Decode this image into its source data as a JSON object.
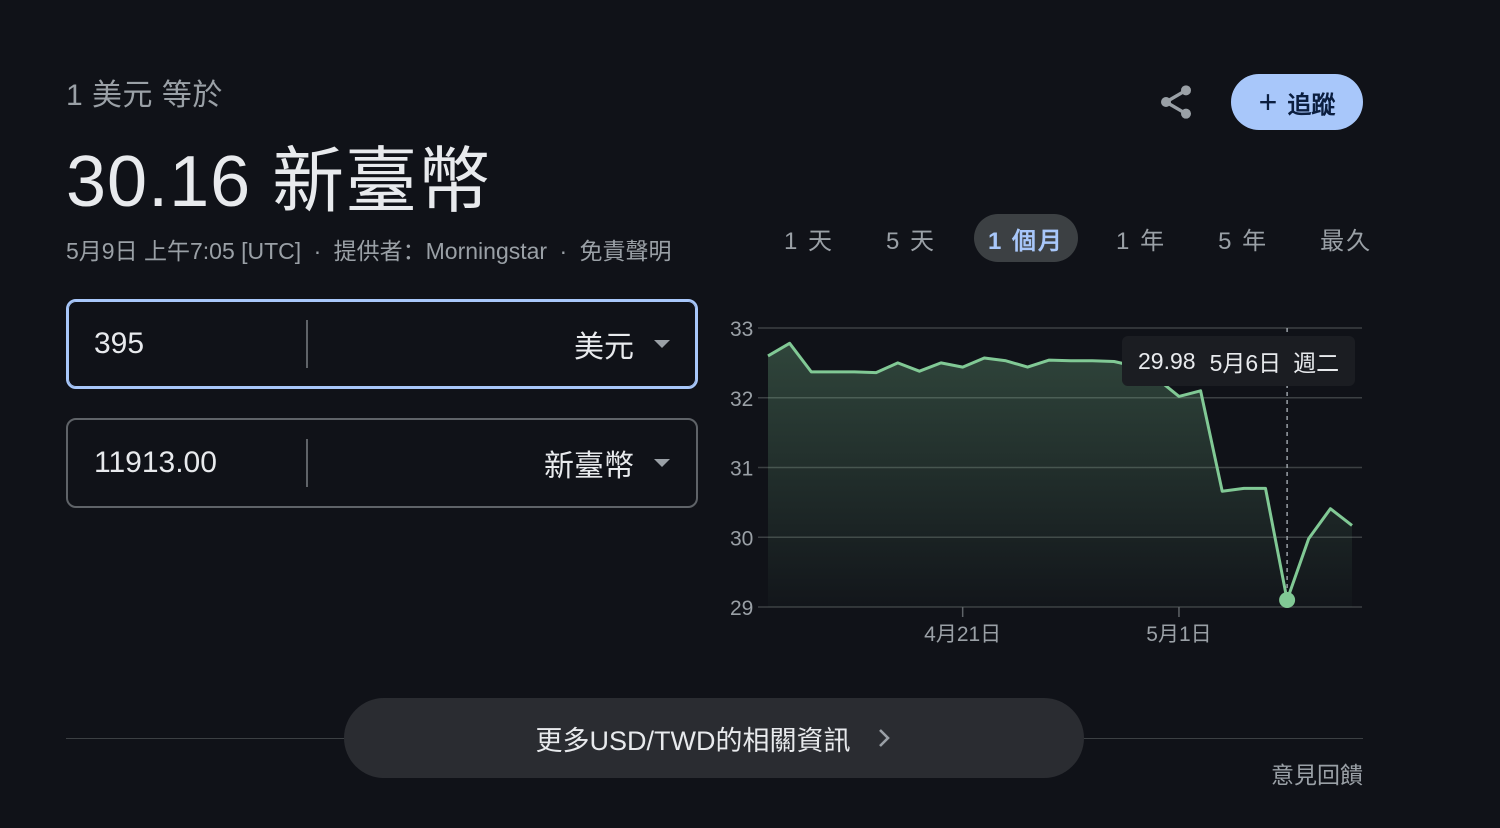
{
  "header": {
    "equals_label": "1 美元 等於",
    "result": "30.16 新臺幣",
    "date": "5月9日 上午7:05 [UTC]",
    "provider": "提供者：Morningstar",
    "disclaimer": "免責聲明",
    "separator": "·"
  },
  "actions": {
    "share_icon": "share-icon",
    "follow_label": "追蹤",
    "follow_icon": "plus-icon"
  },
  "converter": {
    "from_amount": "395",
    "from_currency": "美元",
    "to_amount": "11913.00",
    "to_currency": "新臺幣"
  },
  "range_tabs": [
    {
      "label": "1 天"
    },
    {
      "label": "5 天"
    },
    {
      "label": "1 個月",
      "selected": true
    },
    {
      "label": "1 年"
    },
    {
      "label": "5 年"
    },
    {
      "label": "最久"
    }
  ],
  "tooltip": {
    "value": "29.98",
    "date": "5月6日",
    "day": "週二"
  },
  "chart_data": {
    "type": "area",
    "ylim": [
      29,
      33
    ],
    "yticks": [
      "33",
      "32",
      "31",
      "30",
      "29"
    ],
    "xticks": [
      {
        "label": "4月21日",
        "x": 9
      },
      {
        "label": "5月1日",
        "x": 19
      }
    ],
    "line_color": "#81c995",
    "highlight_index": 24,
    "x": [
      0,
      1,
      2,
      3,
      4,
      5,
      6,
      7,
      8,
      9,
      10,
      11,
      12,
      13,
      14,
      15,
      16,
      17,
      18,
      19,
      20,
      21,
      22,
      23,
      24,
      25,
      26,
      27
    ],
    "values": [
      32.6,
      32.78,
      32.37,
      32.37,
      32.37,
      32.36,
      32.5,
      32.38,
      32.5,
      32.44,
      32.57,
      32.53,
      32.44,
      32.54,
      32.53,
      32.53,
      32.52,
      32.45,
      32.27,
      32.02,
      32.1,
      30.66,
      30.7,
      30.7,
      29.1,
      29.98,
      30.41,
      30.17
    ]
  },
  "footer": {
    "more_label": "更多USD/TWD的相關資訊",
    "feedback_label": "意見回饋"
  }
}
